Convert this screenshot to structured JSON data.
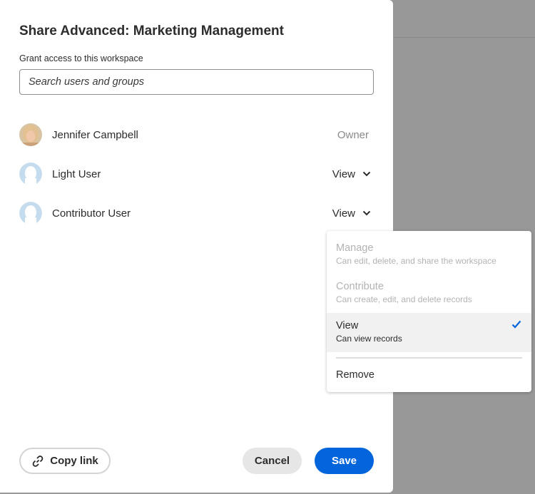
{
  "dialog": {
    "title": "Share Advanced: Marketing Management",
    "grant_label": "Grant access to this workspace",
    "search_placeholder": "Search users and groups"
  },
  "users": [
    {
      "name": "Jennifer Campbell",
      "role": "Owner",
      "avatar": "photo"
    },
    {
      "name": "Light User",
      "role": "View",
      "avatar": "default"
    },
    {
      "name": "Contributor User",
      "role": "View",
      "avatar": "default"
    }
  ],
  "role_menu": {
    "options": [
      {
        "label": "Manage",
        "description": "Can edit, delete, and share the workspace",
        "disabled": true
      },
      {
        "label": "Contribute",
        "description": "Can create, edit, and delete records",
        "disabled": true
      },
      {
        "label": "View",
        "description": "Can view records",
        "selected": true
      }
    ],
    "remove_label": "Remove"
  },
  "footer": {
    "copy_link": "Copy link",
    "cancel": "Cancel",
    "save": "Save"
  },
  "colors": {
    "accent": "#0265dc",
    "overlay": "#989898"
  }
}
